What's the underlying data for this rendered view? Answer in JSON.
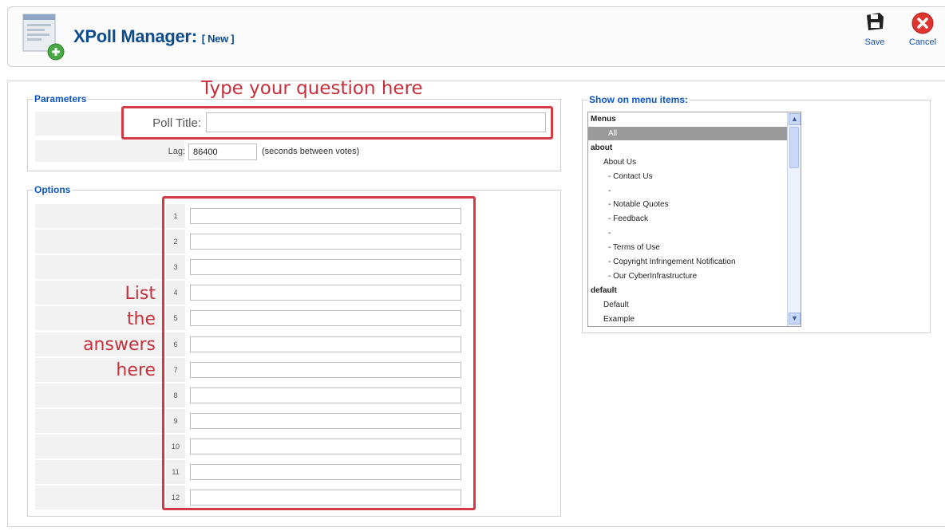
{
  "header": {
    "title": "XPoll Manager:",
    "subtitle": "[ New ]",
    "save_label": "Save",
    "cancel_label": "Cancel",
    "save_icon": "floppy-disk-icon",
    "cancel_icon": "close-circle-icon",
    "logo_icon": "poll-logo-icon"
  },
  "parameters": {
    "legend": "Parameters",
    "poll_title_label": "Poll Title:",
    "poll_title_value": "",
    "lag_label": "Lag:",
    "lag_value": "86400",
    "lag_hint": "(seconds between votes)"
  },
  "options": {
    "legend": "Options",
    "rows": [
      {
        "num": "1",
        "value": ""
      },
      {
        "num": "2",
        "value": ""
      },
      {
        "num": "3",
        "value": ""
      },
      {
        "num": "4",
        "value": ""
      },
      {
        "num": "5",
        "value": ""
      },
      {
        "num": "6",
        "value": ""
      },
      {
        "num": "7",
        "value": ""
      },
      {
        "num": "8",
        "value": ""
      },
      {
        "num": "9",
        "value": ""
      },
      {
        "num": "10",
        "value": ""
      },
      {
        "num": "11",
        "value": ""
      },
      {
        "num": "12",
        "value": ""
      }
    ]
  },
  "menus_panel": {
    "legend": "Show on menu items:",
    "items": [
      {
        "text": "Menus",
        "kind": "group"
      },
      {
        "text": "All",
        "kind": "selected"
      },
      {
        "text": "about",
        "kind": "group"
      },
      {
        "text": "About Us",
        "kind": "item1"
      },
      {
        "text": "- Contact Us",
        "kind": "item2"
      },
      {
        "text": "-",
        "kind": "item2"
      },
      {
        "text": "- Notable Quotes",
        "kind": "item2"
      },
      {
        "text": "- Feedback",
        "kind": "item2"
      },
      {
        "text": "-",
        "kind": "item2"
      },
      {
        "text": "- Terms of Use",
        "kind": "item2"
      },
      {
        "text": "- Copyright Infringement Notification",
        "kind": "item2"
      },
      {
        "text": "- Our CyberInfrastructure",
        "kind": "item2"
      },
      {
        "text": "default",
        "kind": "group"
      },
      {
        "text": "Default",
        "kind": "item1"
      },
      {
        "text": "Example",
        "kind": "item1"
      }
    ]
  },
  "annotations": {
    "question_note": "Type your question here",
    "answers_note": [
      "List",
      "the",
      "answers",
      "here"
    ]
  },
  "colors": {
    "title_blue": "#0c4b8c",
    "link_blue": "#0b55c4",
    "annotation_red": "#c6303b"
  }
}
